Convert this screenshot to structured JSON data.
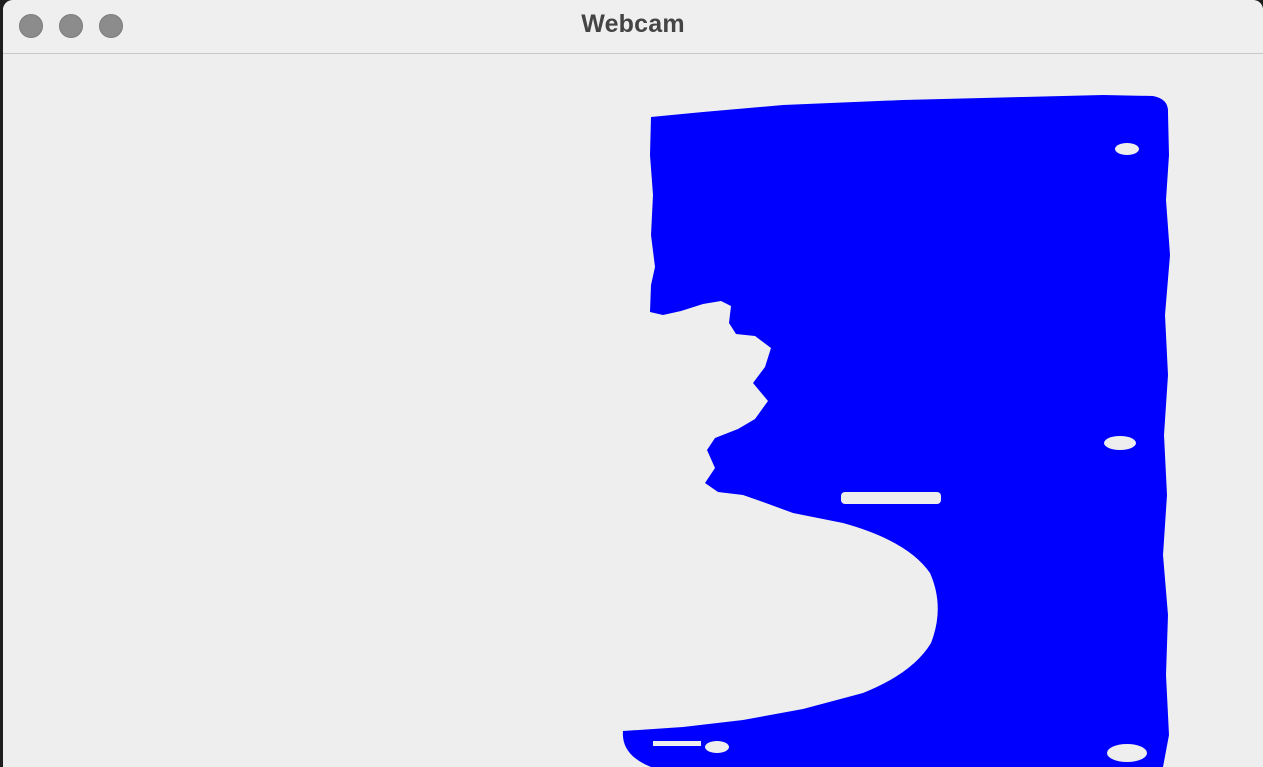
{
  "window": {
    "title": "Webcam"
  },
  "titlebar": {
    "buttons": [
      "close",
      "minimize",
      "maximize"
    ]
  },
  "frame": {
    "mask_color": "#0000ff",
    "background_color": "#eeeeee"
  }
}
